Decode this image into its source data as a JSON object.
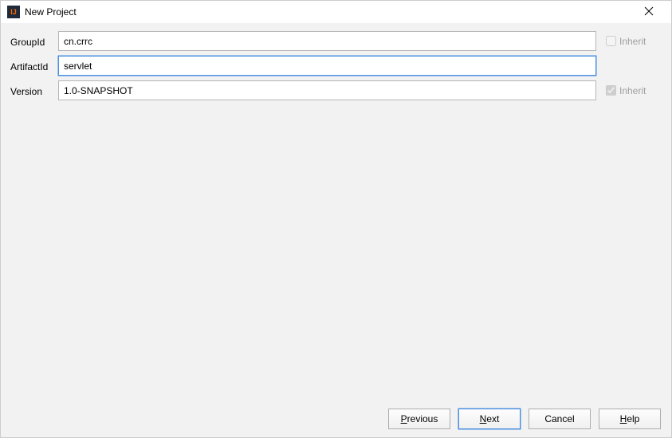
{
  "window": {
    "title": "New Project"
  },
  "form": {
    "groupId": {
      "label": "GroupId",
      "value": "cn.crrc",
      "inherit_label": "Inherit",
      "inherit_checked": false,
      "has_inherit": true
    },
    "artifactId": {
      "label": "ArtifactId",
      "value": "servlet",
      "has_inherit": false
    },
    "version": {
      "label": "Version",
      "value": "1.0-SNAPSHOT",
      "inherit_label": "Inherit",
      "inherit_checked": true,
      "has_inherit": true
    }
  },
  "buttons": {
    "previous": "Previous",
    "next": "Next",
    "cancel": "Cancel",
    "help": "Help"
  },
  "mnemonic": {
    "previous": "P",
    "next": "N",
    "help": "H"
  }
}
